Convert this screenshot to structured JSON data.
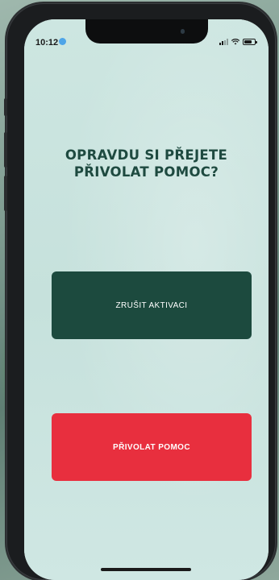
{
  "status_bar": {
    "time": "10:12",
    "signal_bars": 2,
    "battery_level": 0.75
  },
  "prompt": {
    "line1": "OPRAVDU SI PŘEJETE",
    "line2": "PŘIVOLAT POMOC?"
  },
  "buttons": {
    "cancel_label": "ZRUŠIT AKTIVACI",
    "call_label": "PŘIVOLAT POMOC"
  },
  "colors": {
    "accent_dark_green": "#1c4a3e",
    "accent_red": "#e82f3e",
    "background": "#cfe6e2"
  }
}
